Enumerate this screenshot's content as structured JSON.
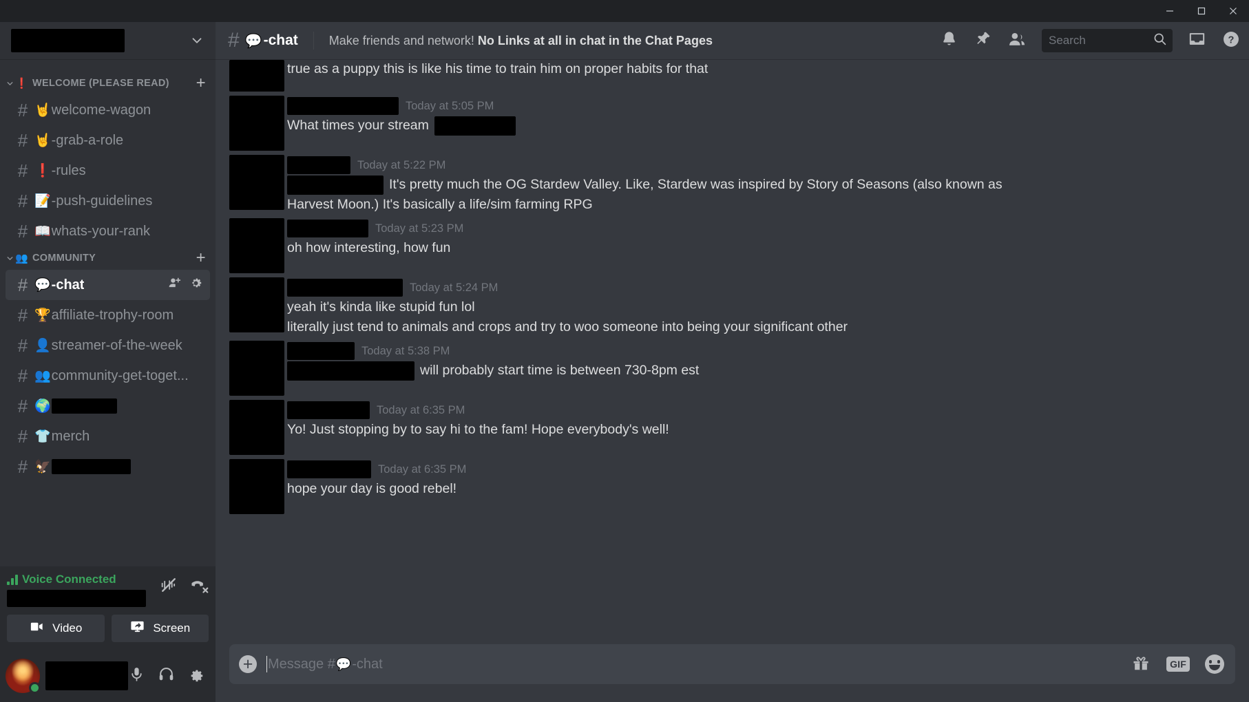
{
  "window": {
    "minimize_label": "Minimize",
    "maximize_label": "Maximize",
    "close_label": "Close"
  },
  "sidebar": {
    "server_name_redacted": true,
    "categories": [
      {
        "emoji": "❗",
        "label": "WELCOME (PLEASE READ)",
        "add_label": "+",
        "channels": [
          {
            "emoji": "🤘",
            "name": "welcome-wagon",
            "redacted": false,
            "active": false
          },
          {
            "emoji": "🤘",
            "name": "-grab-a-role",
            "redacted": false,
            "active": false
          },
          {
            "emoji": "❗",
            "name": "-rules",
            "redacted": false,
            "active": false
          },
          {
            "emoji": "📝",
            "name": "-push-guidelines",
            "redacted": false,
            "active": false
          },
          {
            "emoji": "📖",
            "name": "whats-your-rank",
            "redacted": false,
            "active": false
          }
        ]
      },
      {
        "emoji": "👥",
        "label": "COMMUNITY",
        "add_label": "+",
        "channels": [
          {
            "emoji": "💬",
            "name": "-chat",
            "redacted": false,
            "active": true
          },
          {
            "emoji": "🏆",
            "name": "affiliate-trophy-room",
            "redacted": false,
            "active": false
          },
          {
            "emoji": "👤",
            "name": "streamer-of-the-week",
            "redacted": false,
            "active": false
          },
          {
            "emoji": "👥",
            "name": "community-get-toget...",
            "redacted": false,
            "active": false
          },
          {
            "emoji": "🌍",
            "name": "",
            "redacted": true,
            "redact_width": 95,
            "active": false
          },
          {
            "emoji": "👕",
            "name": "merch",
            "redacted": false,
            "active": false
          },
          {
            "emoji": "🦅",
            "name": "",
            "redacted": true,
            "redact_width": 115,
            "active": false
          }
        ]
      }
    ],
    "voice": {
      "status_label": "Voice Connected",
      "channel_redacted": true,
      "noise_icon": "noise-suppression-icon",
      "disconnect_icon": "disconnect-call-icon",
      "video_label": "Video",
      "screen_label": "Screen"
    },
    "user": {
      "name_redacted": true,
      "presence": "online",
      "mic_icon": "microphone-icon",
      "headphones_icon": "headphones-icon",
      "settings_icon": "gear-icon"
    }
  },
  "header": {
    "hash": "#",
    "channel_emoji": "💬",
    "channel_name": "-chat",
    "topic_normal": "Make friends and network! ",
    "topic_bold": "No Links at all in chat in the Chat Pages",
    "icons": [
      "bell-icon",
      "pin-icon",
      "members-icon",
      "inbox-icon",
      "help-icon"
    ],
    "search": {
      "placeholder": "Search",
      "value": ""
    }
  },
  "messages": [
    {
      "id": "m1",
      "grouped": true,
      "author_redacted": true,
      "author_redact_width": 62,
      "time": "",
      "text_before": "",
      "text": "true as a puppy this is like his time to train him on proper habits for that",
      "lines": []
    },
    {
      "id": "m2",
      "grouped": false,
      "author_redacted": true,
      "author_redact_width": 162,
      "time": "Today at 5:05 PM",
      "text": "What times your stream",
      "trailing_redact_width": 118,
      "lines": []
    },
    {
      "id": "m3",
      "grouped": false,
      "author_redacted": true,
      "author_redact_width": 92,
      "time": "Today at 5:22 PM",
      "leading_redact_width": 140,
      "text": "It's pretty much the OG Stardew Valley. Like, Stardew was inspired by Story of Seasons (also known as",
      "lines": [
        "Harvest Moon.) It's basically a life/sim farming RPG"
      ]
    },
    {
      "id": "m4",
      "grouped": false,
      "author_redacted": true,
      "author_redact_width": 118,
      "time": "Today at 5:23 PM",
      "text": "oh how interesting, how fun",
      "lines": []
    },
    {
      "id": "m5",
      "grouped": false,
      "author_redacted": true,
      "author_redact_width": 168,
      "time": "Today at 5:24 PM",
      "text": "yeah it's kinda like stupid fun lol",
      "lines": [
        "literally just tend to animals and crops and try to woo someone into being your significant other"
      ]
    },
    {
      "id": "m6",
      "grouped": false,
      "author_redacted": true,
      "author_redact_width": 98,
      "time": "Today at 5:38 PM",
      "leading_redact_width": 185,
      "text": "will probably start time is between 730-8pm est",
      "lines": []
    },
    {
      "id": "m7",
      "grouped": false,
      "author_redacted": true,
      "author_redact_width": 120,
      "time": "Today at 6:35 PM",
      "text": "Yo! Just stopping by to say hi to the fam! Hope everybody's well!",
      "lines": []
    },
    {
      "id": "m8",
      "grouped": false,
      "author_redacted": true,
      "author_redact_width": 122,
      "time": "Today at 6:35 PM",
      "text": "hope your day  is good rebel!",
      "lines": []
    }
  ],
  "composer": {
    "placeholder_prefix": "Message #",
    "placeholder_emoji": "💬",
    "placeholder_suffix": "-chat",
    "value": "",
    "gift_icon": "gift-icon",
    "gif_label": "GIF",
    "emoji_icon": "emoji-icon"
  },
  "colors": {
    "accent_green": "#3ba55d",
    "sidebar_bg": "#2f3136",
    "main_bg": "#36393f",
    "titlebar_bg": "#202225",
    "text_muted": "#8e9297",
    "text_normal": "#dcddde"
  }
}
